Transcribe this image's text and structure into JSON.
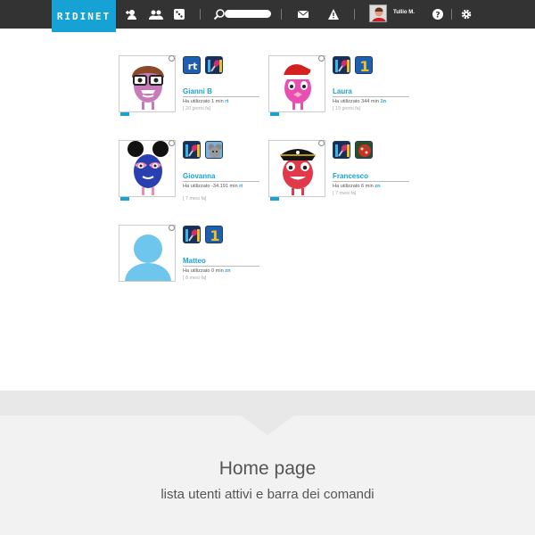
{
  "app": {
    "logo": "RIDINET"
  },
  "topbar": {
    "icons": [
      "add-user-icon",
      "users-group-icon",
      "dice-icon",
      "search-icon",
      "mail-icon",
      "alert-icon",
      "help-icon",
      "gear-icon"
    ],
    "search_placeholder": "",
    "user_name": "Tullio M."
  },
  "users": [
    {
      "name": "Gianni B",
      "usage_prefix": "Ha utilizzato 1 min",
      "code": "rt",
      "since": "[ 20 giorni fa]",
      "avatar": "monster-glasses-icon",
      "apps": [
        "rt-app-icon",
        "microphone-app-icon"
      ]
    },
    {
      "name": "Laura",
      "usage_prefix": "Ha utilizzato 344 min",
      "code": "1n",
      "since": "[ 19 giorni fa]",
      "avatar": "monster-santa-icon",
      "apps": [
        "microphone-app-icon",
        "number-one-app-icon"
      ]
    },
    {
      "name": "Giovanna",
      "usage_prefix": "Ha utilizzato -34.191 min",
      "code": "rt",
      "since": "[ 7 mesi fa]",
      "avatar": "monster-mouse-ears-icon",
      "apps": [
        "microphone-app-icon",
        "mouse-app-icon"
      ]
    },
    {
      "name": "Francesco",
      "usage_prefix": "Ha utilizzato 6 min",
      "code": "zn",
      "since": "[ 7 mesi fa]",
      "avatar": "monster-pirate-icon",
      "apps": [
        "microphone-app-icon",
        "pizza-app-icon"
      ]
    },
    {
      "name": "Matteo",
      "usage_prefix": "Ha utilizzato 0 min",
      "code": "zn",
      "since": "[ 8 mesi fa]",
      "avatar": "default-user-silhouette-icon",
      "apps": [
        "microphone-app-icon",
        "number-one-app-icon"
      ]
    }
  ],
  "footer": {
    "title": "Home page",
    "subtitle": "lista utenti attivi e barra dei comandi"
  },
  "colors": {
    "accent": "#17a2d6",
    "topbar": "#333333",
    "footer": "#f2f2f2"
  }
}
